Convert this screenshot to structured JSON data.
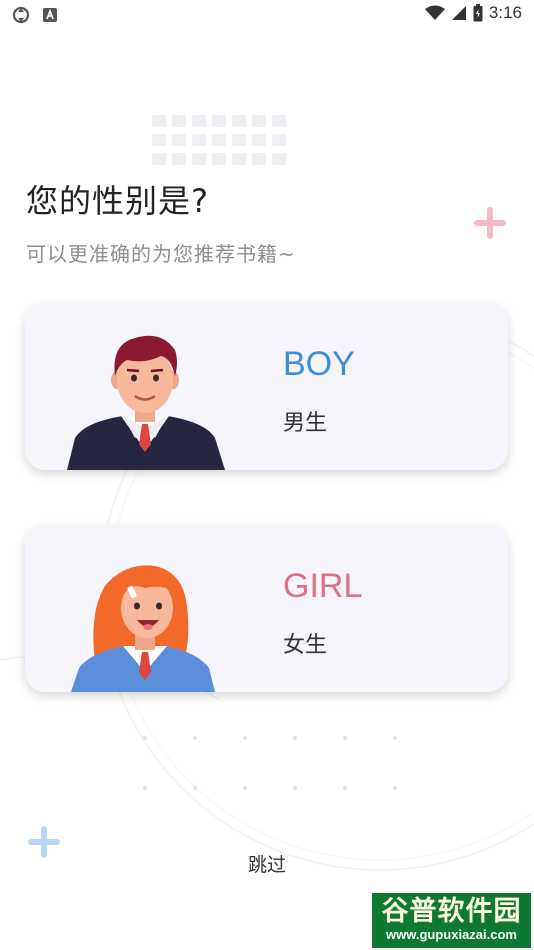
{
  "status_bar": {
    "time": "3:16",
    "left_icons": [
      "sync-icon",
      "a-badge-icon"
    ],
    "right_icons": [
      "wifi-icon",
      "signal-icon",
      "battery-icon"
    ]
  },
  "header": {
    "title": "您的性别是?",
    "subtitle": "可以更准确的为您推荐书籍~"
  },
  "options": [
    {
      "id": "boy",
      "label_en": "BOY",
      "label_zh": "男生",
      "accent": "#3d8ddd",
      "avatar": "boy-avatar"
    },
    {
      "id": "girl",
      "label_en": "GIRL",
      "label_zh": "女生",
      "accent": "#e07087",
      "avatar": "girl-avatar"
    }
  ],
  "skip_label": "跳过",
  "watermark": {
    "title": "谷普软件园",
    "url": "www.gupuxiazai.com"
  },
  "colors": {
    "card_bg": "#f6f5fb",
    "plus_pink": "#f6b9c8",
    "plus_blue": "#b9d6f6"
  }
}
